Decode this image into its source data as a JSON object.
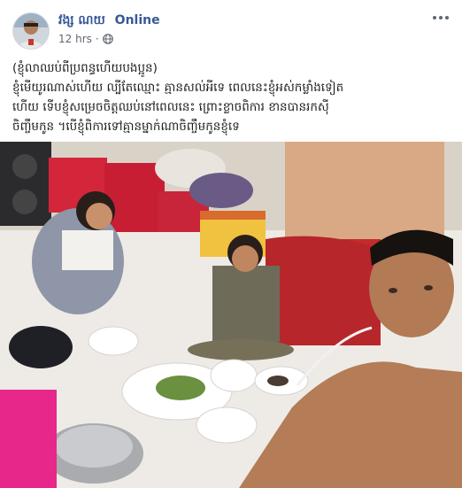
{
  "post": {
    "author": "វង្ស ណយ",
    "status": "Online",
    "time": "12 hrs",
    "privacy_icon": "globe-icon",
    "more_icon": "more-dots-icon",
    "text_line1": "(ខ្ញុំលាឈប់ពីប្រពន្ធហើយបងប្អូន)",
    "text_line2": "ខ្ញុំមើយូរណាស់ហើយ ល្បីតែឈ្មោះ គ្មានសល់អីទេ ពេលនេះខ្ញុំអស់កម្លាំងទៀត",
    "text_line3": "ហើយ ទើបខ្ញុំសម្រេចចិត្តឈប់នៅពេលនេះ ព្រោះខ្លាចពិការ ខានបានរកស៊ី",
    "text_line4": "ចិញ្ចឹមកូន ។បើខ្ញុំពិការទៅគ្មានម្នាក់ណាចិញ្ចឹមកូនខ្ញុំទេ"
  },
  "colors": {
    "name": "#385898",
    "meta": "#606770",
    "text": "#1c1e21"
  }
}
